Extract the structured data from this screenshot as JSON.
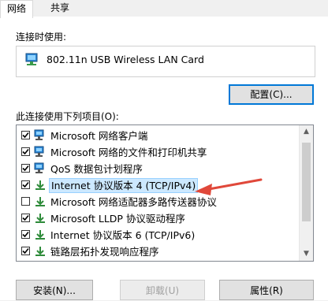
{
  "tabs": [
    {
      "label": "网络",
      "active": true
    },
    {
      "label": "共享",
      "active": false
    }
  ],
  "connect_using_label": "连接时使用:",
  "adapter_name": "802.11n USB Wireless LAN Card",
  "configure_button": "配置(C)...",
  "items_label": "此连接使用下列项目(O):",
  "items": [
    {
      "label": "Microsoft 网络客户端",
      "checked": true,
      "icon": "network-client-icon"
    },
    {
      "label": "Microsoft 网络的文件和打印机共享",
      "checked": true,
      "icon": "file-printer-sharing-icon"
    },
    {
      "label": "QoS 数据包计划程序",
      "checked": true,
      "icon": "qos-icon"
    },
    {
      "label": "Internet 协议版本 4 (TCP/IPv4)",
      "checked": true,
      "icon": "protocol-icon",
      "selected": true
    },
    {
      "label": "Microsoft 网络适配器多路传送器协议",
      "checked": false,
      "icon": "protocol-icon"
    },
    {
      "label": "Microsoft LLDP 协议驱动程序",
      "checked": true,
      "icon": "protocol-icon"
    },
    {
      "label": "Internet 协议版本 6 (TCP/IPv6)",
      "checked": true,
      "icon": "protocol-icon"
    },
    {
      "label": "链路层拓扑发现响应程序",
      "checked": true,
      "icon": "protocol-icon"
    }
  ],
  "buttons": {
    "install": "安装(N)...",
    "uninstall": "卸载(U)",
    "properties": "属性(R)"
  },
  "colors": {
    "accent": "#0078d7",
    "selection": "#cce8ff",
    "arrow": "#e0483a"
  }
}
